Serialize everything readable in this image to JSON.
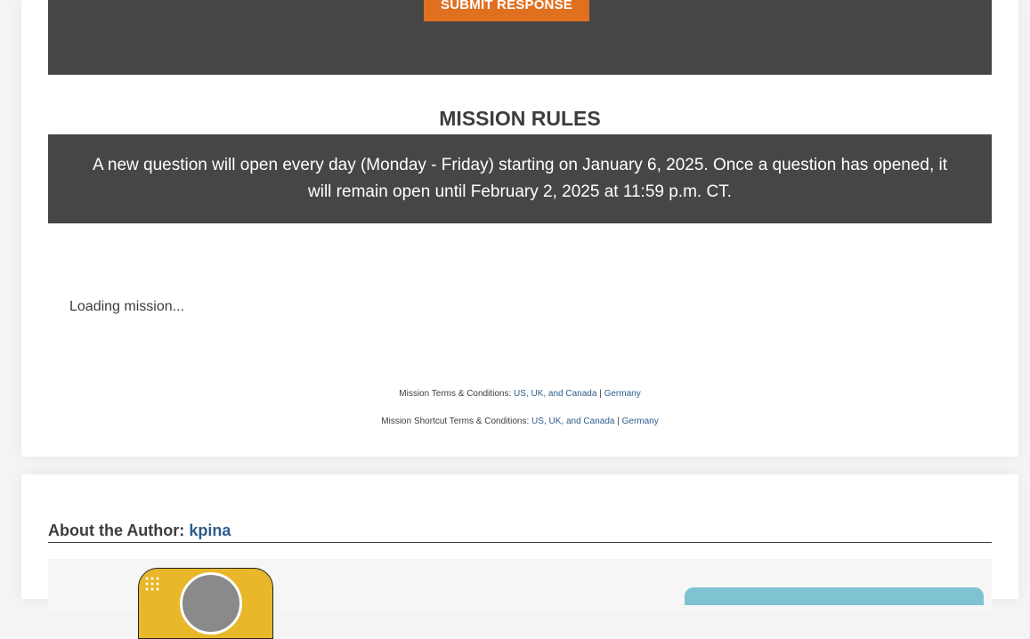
{
  "submit": {
    "label": "SUBMIT RESPONSE"
  },
  "rules": {
    "title": "MISSION RULES",
    "text": "A new question will open every day (Monday - Friday) starting on January 6, 2025. Once a question has opened, it will remain open until February 2, 2025 at 11:59 p.m. CT."
  },
  "mission": {
    "loading_text": "Loading mission..."
  },
  "terms": {
    "line1_label": "Mission Terms & Conditions:",
    "line2_label": "Mission Shortcut Terms & Conditions:",
    "link_us_uk_ca": "US, UK, and Canada",
    "separator": "|",
    "link_germany": "Germany"
  },
  "author": {
    "heading_label": "About the Author:",
    "name": "kpina"
  },
  "colors": {
    "accent_orange": "#e07020",
    "dark_band": "#464646",
    "link_blue": "#2d5d8c",
    "avatar_yellow": "#e8b72a",
    "side_teal": "#7fc3d3"
  }
}
